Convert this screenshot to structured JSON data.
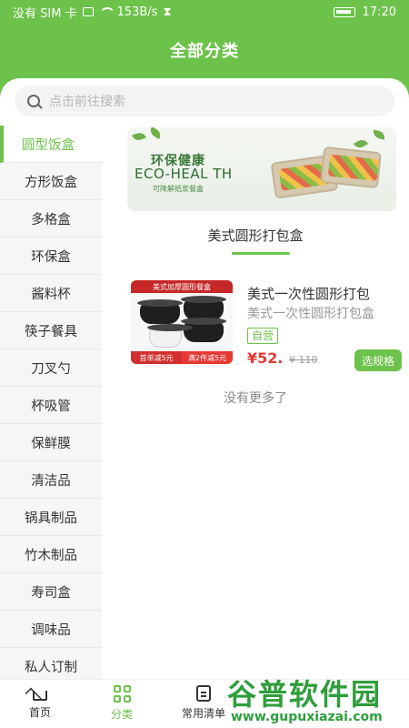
{
  "status_bar": {
    "carrier": "没有 SIM 卡",
    "speed": "153B/s",
    "time": "17:20"
  },
  "header": {
    "title": "全部分类"
  },
  "search": {
    "placeholder": "点击前往搜索"
  },
  "sidebar": {
    "items": [
      {
        "label": "圆型饭盒",
        "active": true
      },
      {
        "label": "方形饭盒"
      },
      {
        "label": "多格盒"
      },
      {
        "label": "环保盒"
      },
      {
        "label": "酱料杯"
      },
      {
        "label": "筷子餐具"
      },
      {
        "label": "刀叉勺"
      },
      {
        "label": "杯吸管"
      },
      {
        "label": "保鲜膜"
      },
      {
        "label": "清洁品"
      },
      {
        "label": "锅具制品"
      },
      {
        "label": "竹木制品"
      },
      {
        "label": "寿司盒"
      },
      {
        "label": "调味品"
      },
      {
        "label": "私人订制"
      }
    ]
  },
  "banner": {
    "title_cn": "环保健康",
    "title_en": "ECO-HEAL TH",
    "subtitle": "可降解纸浆餐盒"
  },
  "category": {
    "title": "美式圆形打包盒"
  },
  "products": [
    {
      "name": "美式一次性圆形打包",
      "subtitle": "美式一次性圆形打包盒",
      "tag": "自营",
      "price": "¥52.",
      "old_price": "¥ 110",
      "button": "选规格",
      "image_top_text": "美式加厚圆形餐盒",
      "image_badge_left": "首单减5元",
      "image_badge_right": "满2件减5元"
    }
  ],
  "no_more": "没有更多了",
  "tabbar": {
    "items": [
      {
        "label": "首页",
        "icon": "home-icon"
      },
      {
        "label": "分类",
        "icon": "grid-icon",
        "active": true
      },
      {
        "label": "常用清单",
        "icon": "list-icon"
      }
    ]
  },
  "watermark": {
    "main": "谷普软件园",
    "url": "www.gupuxiazai.com"
  },
  "colors": {
    "brand_green": "#6cc24a",
    "price_red": "#e53935"
  }
}
